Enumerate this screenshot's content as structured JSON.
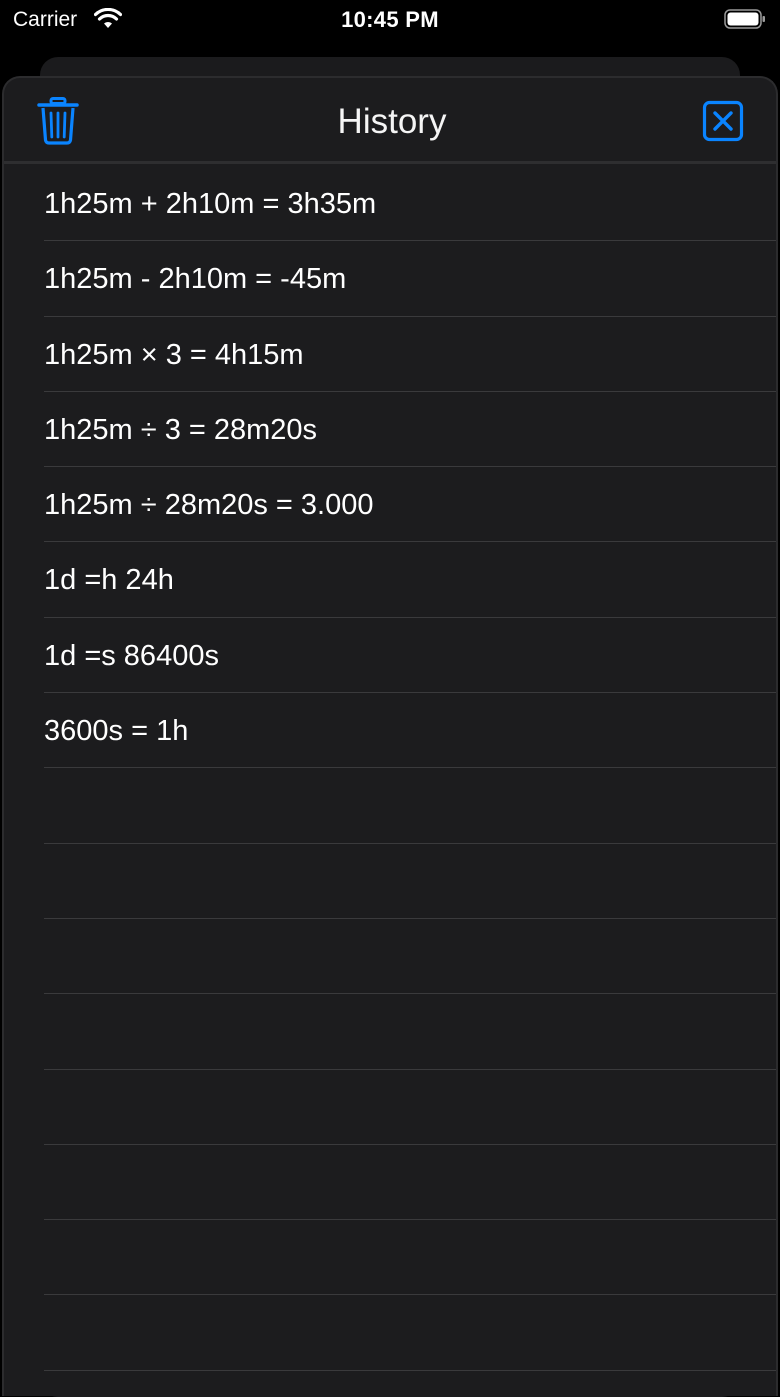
{
  "status_bar": {
    "carrier": "Carrier",
    "time": "10:45 PM"
  },
  "header": {
    "title": "History",
    "trash_icon": "trash-icon",
    "close_icon": "close-box-icon",
    "accent_color": "#0a84ff"
  },
  "history": {
    "items": [
      "1h25m + 2h10m = 3h35m",
      "1h25m - 2h10m = -45m",
      "1h25m × 3 = 4h15m",
      "1h25m ÷ 3 = 28m20s",
      "1h25m ÷ 28m20s = 3.000",
      "1d =h 24h",
      "1d =s 86400s",
      "3600s = 1h",
      "",
      "",
      "",
      "",
      "",
      "",
      "",
      ""
    ]
  }
}
